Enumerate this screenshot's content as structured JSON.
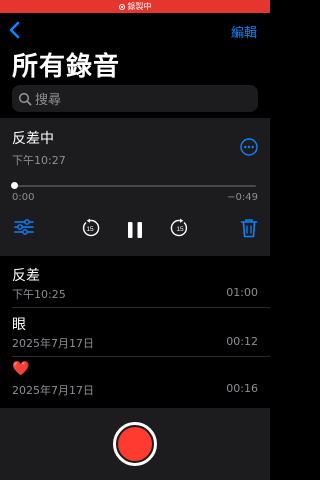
{
  "status": {
    "recording_label": "錄製中"
  },
  "nav": {
    "edit_label": "編輯"
  },
  "page": {
    "title": "所有錄音"
  },
  "search": {
    "placeholder": "搜尋"
  },
  "active_recording": {
    "name": "反差中",
    "time": "下午10:27",
    "elapsed": "0:00",
    "remaining": "−0:49",
    "progress": 0.0,
    "skip_seconds": "15"
  },
  "recordings": [
    {
      "name": "反差",
      "date": "下午10:25",
      "duration": "01:00"
    },
    {
      "name": "眼",
      "date": "2025年7月17日",
      "duration": "00:12"
    },
    {
      "name": "❤️",
      "date": "2025年7月17日",
      "duration": "00:16"
    }
  ],
  "colors": {
    "accent": "#0a84ff",
    "record": "#ff3b30",
    "status_bar": "#e5352f"
  },
  "icons": [
    "back-chevron-icon",
    "search-icon",
    "more-icon",
    "settings-sliders-icon",
    "skip-back-15-icon",
    "pause-icon",
    "skip-forward-15-icon",
    "trash-icon",
    "record-icon"
  ]
}
